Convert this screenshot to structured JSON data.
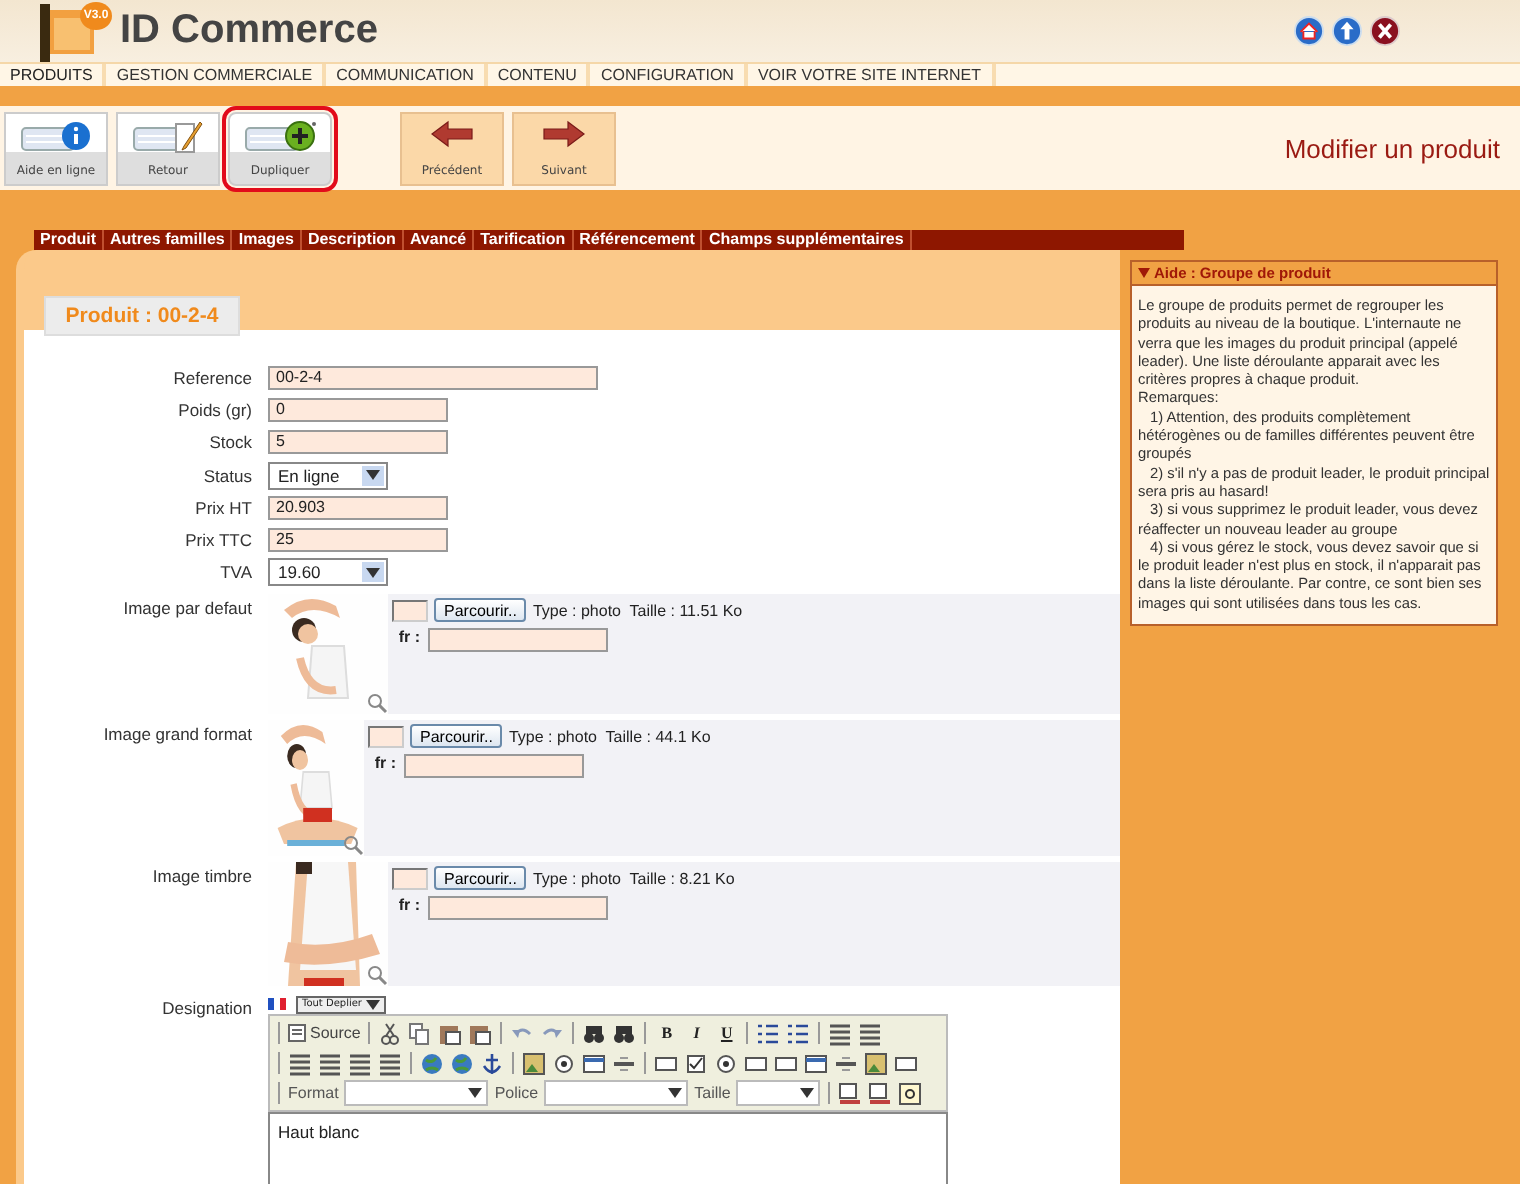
{
  "header": {
    "logo_badge": "V3.0",
    "title": "ID Commerce"
  },
  "menu": [
    "PRODUITS",
    "GESTION COMMERCIALE",
    "COMMUNICATION",
    "CONTENU",
    "CONFIGURATION",
    "VOIR VOTRE SITE INTERNET"
  ],
  "toolbar": {
    "buttons": [
      {
        "label": "Aide en ligne",
        "kind": "help",
        "highlighted": false
      },
      {
        "label": "Retour",
        "kind": "back",
        "highlighted": false
      },
      {
        "label": "Dupliquer",
        "kind": "duplicate",
        "highlighted": true
      },
      {
        "label": "Précédent",
        "kind": "previous",
        "highlighted": false
      },
      {
        "label": "Suivant",
        "kind": "next",
        "highlighted": false
      }
    ],
    "page_title": "Modifier un produit"
  },
  "tabs": [
    "Produit",
    "Autres familles",
    "Images",
    "Description",
    "Avancé",
    "Tarification",
    "Référencement",
    "Champs supplémentaires"
  ],
  "product_header": "Produit : 00-2-4",
  "fields": [
    {
      "label": "Reference",
      "value": "00-2-4",
      "kind": "long-text"
    },
    {
      "label": "Poids (gr)",
      "value": "0",
      "kind": "text"
    },
    {
      "label": "Stock",
      "value": "5",
      "kind": "text"
    },
    {
      "label": "Status",
      "value": "En ligne",
      "kind": "select"
    },
    {
      "label": "Prix HT",
      "value": "20.903",
      "kind": "text"
    },
    {
      "label": "Prix TTC",
      "value": "25",
      "kind": "text"
    },
    {
      "label": "TVA",
      "value": "19.60",
      "kind": "select"
    }
  ],
  "images": [
    {
      "label": "Image par defaut",
      "button": "Parcourir..",
      "info": "Type : photo  Taille : 11.51 Ko",
      "lang_label": "fr :"
    },
    {
      "label": "Image grand format",
      "button": "Parcourir..",
      "info": "Type : photo  Taille : 44.1 Ko",
      "lang_label": "fr :"
    },
    {
      "label": "Image timbre",
      "button": "Parcourir..",
      "info": "Type : photo  Taille : 8.21 Ko",
      "lang_label": "fr :"
    }
  ],
  "designation": {
    "label": "Designation",
    "expand_button": "Tout Deplier",
    "source_button": "Source",
    "style_buttons": [
      "B",
      "I",
      "U"
    ],
    "format_label": "Format",
    "font_label": "Police",
    "size_label": "Taille",
    "content": "Haut blanc"
  },
  "help": {
    "title": "Aide : Groupe de produit",
    "intro": "Le groupe de produits permet de regrouper les produits au niveau de la boutique. L'internaute ne verra que les images du produit principal (appelé leader). Une liste déroulante apparait avec les critères propres à chaque produit.",
    "remarks_title": "Remarques:",
    "remarks": [
      "1) Attention, des produits complètement hétérogènes ou de familles différentes peuvent être groupés",
      "2) s'il n'y a pas de produit leader, le produit principal sera pris au hasard!",
      "3) si vous supprimez le produit leader, vous devez réaffecter un nouveau leader au groupe",
      "4) si vous gérez le stock, vous devez savoir que si le produit leader n'est plus en stock, il n'apparait pas dans la liste déroulante. Par contre, ce sont bien ses images qui sont utilisées dans tous les cas."
    ]
  }
}
